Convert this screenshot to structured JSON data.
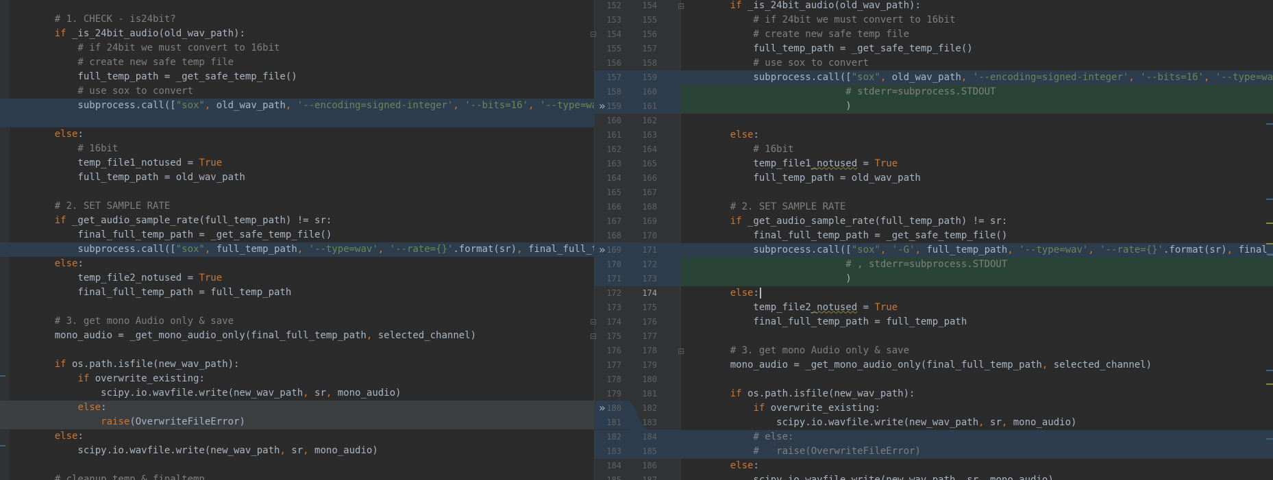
{
  "editor": {
    "accent_blue": "#2e3d4d",
    "accent_green": "#294436",
    "keyword_color": "#cc7832",
    "string_color": "#6a8759",
    "comment_color": "#808080"
  },
  "left": [
    {
      "t": "    # 1. CHECK - is24bit?"
    },
    {
      "t": "    if _is_24bit_audio(old_wav_path):"
    },
    {
      "t": "        # if 24bit we must convert to 16bit"
    },
    {
      "t": "        # create new safe temp file"
    },
    {
      "t": "        full_temp_path = _get_safe_temp_file()"
    },
    {
      "t": "        # use sox to convert"
    },
    {
      "t": "        subprocess.call([\"sox\", old_wav_path, '--encoding=signed-integer', '--bits=16', '--type=wav', full"
    },
    {
      "t": ""
    },
    {
      "t": "    else:"
    },
    {
      "t": "        # 16bit"
    },
    {
      "t": "        temp_file1_notused = True"
    },
    {
      "t": "        full_temp_path = old_wav_path"
    },
    {
      "t": ""
    },
    {
      "t": "    # 2. SET SAMPLE RATE"
    },
    {
      "t": "    if _get_audio_sample_rate(full_temp_path) != sr:"
    },
    {
      "t": "        final_full_temp_path = _get_safe_temp_file()"
    },
    {
      "t": "        subprocess.call([\"sox\", full_temp_path, '--type=wav', '--rate={}'.format(sr), final_full_temp_path"
    },
    {
      "t": "    else:"
    },
    {
      "t": "        temp_file2_notused = True"
    },
    {
      "t": "        final_full_temp_path = full_temp_path"
    },
    {
      "t": ""
    },
    {
      "t": "    # 3. get mono Audio only & save"
    },
    {
      "t": "    mono_audio = _get_mono_audio_only(final_full_temp_path, selected_channel)"
    },
    {
      "t": ""
    },
    {
      "t": "    if os.path.isfile(new_wav_path):"
    },
    {
      "t": "        if overwrite_existing:"
    },
    {
      "t": "            scipy.io.wavfile.write(new_wav_path, sr, mono_audio)"
    },
    {
      "t": "        else:"
    },
    {
      "t": "            raise(OverwriteFileError)"
    },
    {
      "t": "    else:"
    },
    {
      "t": "        scipy.io.wavfile.write(new_wav_path, sr, mono_audio)"
    },
    {
      "t": ""
    },
    {
      "t": "    # cleanup temp & finaltemp"
    }
  ],
  "gutter": [
    [
      "152",
      "154"
    ],
    [
      "153",
      "155"
    ],
    [
      "154",
      "156"
    ],
    [
      "155",
      "157"
    ],
    [
      "156",
      "158"
    ],
    [
      "157",
      "159"
    ],
    [
      "158",
      "160"
    ],
    [
      "159",
      "161"
    ],
    [
      "160",
      "162"
    ],
    [
      "161",
      "163"
    ],
    [
      "162",
      "164"
    ],
    [
      "163",
      "165"
    ],
    [
      "164",
      "166"
    ],
    [
      "165",
      "167"
    ],
    [
      "166",
      "168"
    ],
    [
      "167",
      "169"
    ],
    [
      "168",
      "170"
    ],
    [
      "169",
      "171"
    ],
    [
      "170",
      "172"
    ],
    [
      "171",
      "173"
    ],
    [
      "172",
      "174"
    ],
    [
      "173",
      "175"
    ],
    [
      "174",
      "176"
    ],
    [
      "175",
      "177"
    ],
    [
      "176",
      "178"
    ],
    [
      "177",
      "179"
    ],
    [
      "178",
      "180"
    ],
    [
      "179",
      "181"
    ],
    [
      "180",
      "182"
    ],
    [
      "181",
      "183"
    ],
    [
      "182",
      "184"
    ],
    [
      "183",
      "185"
    ],
    [
      "184",
      "186"
    ],
    [
      "185",
      "187"
    ]
  ],
  "right": [
    {
      "t": "    if _is_24bit_audio(old_wav_path):"
    },
    {
      "t": "        # if 24bit we must convert to 16bit"
    },
    {
      "t": "        # create new safe temp file"
    },
    {
      "t": "        full_temp_path = _get_safe_temp_file()"
    },
    {
      "t": "        # use sox to convert"
    },
    {
      "t": "        subprocess.call([\"sox\", old_wav_path, '--encoding=signed-integer', '--bits=16', '--type=wav', full_te"
    },
    {
      "t": "                        # stderr=subprocess.STDOUT"
    },
    {
      "t": "                        )"
    },
    {
      "t": ""
    },
    {
      "t": "    else:"
    },
    {
      "t": "        # 16bit"
    },
    {
      "t": "        temp_file1_notused = True"
    },
    {
      "t": "        full_temp_path = old_wav_path"
    },
    {
      "t": ""
    },
    {
      "t": "    # 2. SET SAMPLE RATE"
    },
    {
      "t": "    if _get_audio_sample_rate(full_temp_path) != sr:"
    },
    {
      "t": "        final_full_temp_path = _get_safe_temp_file()"
    },
    {
      "t": "        subprocess.call([\"sox\", '-G', full_temp_path, '--type=wav', '--rate={}'.format(sr), final_full_temp"
    },
    {
      "t": "                        # , stderr=subprocess.STDOUT"
    },
    {
      "t": "                        )"
    },
    {
      "t": "    else:"
    },
    {
      "t": "        temp_file2_notused = True"
    },
    {
      "t": "        final_full_temp_path = full_temp_path"
    },
    {
      "t": ""
    },
    {
      "t": "    # 3. get mono Audio only & save"
    },
    {
      "t": "    mono_audio = _get_mono_audio_only(final_full_temp_path, selected_channel)"
    },
    {
      "t": ""
    },
    {
      "t": "    if os.path.isfile(new_wav_path):"
    },
    {
      "t": "        if overwrite_existing:"
    },
    {
      "t": "            scipy.io.wavfile.write(new_wav_path, sr, mono_audio)"
    },
    {
      "t": "        # else:"
    },
    {
      "t": "        #   raise(OverwriteFileError)"
    },
    {
      "t": "    else:"
    },
    {
      "t": "        scipy.io.wavfile.write(new_wav_path, sr, mono_audio)"
    }
  ],
  "icons": {
    "apply_change": "double-chevron-right-icon",
    "fold": "fold-marker-icon"
  }
}
